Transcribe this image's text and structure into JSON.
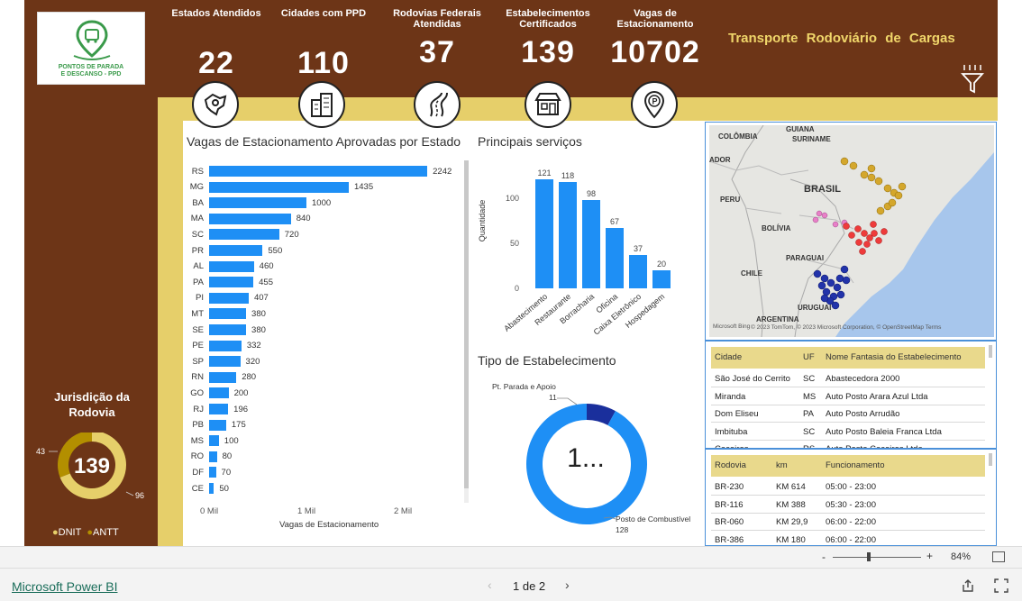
{
  "header": {
    "title": "Transporte Rodoviário de Cargas",
    "kpis": [
      {
        "label": "Estados Atendidos",
        "value": "22",
        "icon": "map-pin-icon"
      },
      {
        "label": "Cidades com PPD",
        "value": "110",
        "icon": "buildings-icon"
      },
      {
        "label": "Rodovias Federais Atendidas",
        "value": "37",
        "icon": "road-icon"
      },
      {
        "label": "Estabelecimentos Certificados",
        "value": "139",
        "icon": "store-icon"
      },
      {
        "label": "Vagas de Estacionamento",
        "value": "10702",
        "icon": "parking-icon"
      }
    ]
  },
  "logo": {
    "line1": "PONTOS DE PARADA",
    "line2": "E DESCANSO - PPD"
  },
  "jurisdiction": {
    "title": "Jurisdição da Rodovia",
    "center": "139",
    "dnit": 96,
    "antt": 43,
    "legend": [
      "DNIT",
      "ANTT"
    ],
    "colors": {
      "dnit": "#e6cf6a",
      "antt": "#b38f00"
    }
  },
  "parking_chart": {
    "title": "Vagas de Estacionamento Aprovadas por Estado",
    "xlabel": "Vagas de Estacionamento",
    "ticks": [
      "0 Mil",
      "1 Mil",
      "2 Mil"
    ]
  },
  "services_chart": {
    "title": "Principais serviços",
    "ylabel": "Quantidade",
    "yticks": [
      "100",
      "50",
      "0"
    ]
  },
  "type_chart": {
    "title": "Tipo de Estabelecimento",
    "center": "1...",
    "label_ppd": "Pt. Parada e Apoio",
    "value_ppd": "11",
    "label_fuel": "Posto de Combustível",
    "value_fuel": "128"
  },
  "chart_data": [
    {
      "type": "bar",
      "title": "Vagas de Estacionamento Aprovadas por Estado",
      "xlabel": "Vagas de Estacionamento",
      "categories": [
        "RS",
        "MG",
        "BA",
        "MA",
        "SC",
        "PR",
        "AL",
        "PA",
        "PI",
        "MT",
        "SE",
        "PE",
        "SP",
        "RN",
        "GO",
        "RJ",
        "PB",
        "MS",
        "RO",
        "DF",
        "CE"
      ],
      "values": [
        2242,
        1435,
        1000,
        840,
        720,
        550,
        460,
        455,
        407,
        380,
        380,
        332,
        320,
        280,
        200,
        196,
        175,
        100,
        80,
        70,
        50
      ],
      "xlim": [
        0,
        2500
      ]
    },
    {
      "type": "bar",
      "title": "Principais serviços",
      "ylabel": "Quantidade",
      "categories": [
        "Abastecimento",
        "Restaurante",
        "Borracharia",
        "Oficina",
        "Caixa Eletrônico",
        "Hospedagem"
      ],
      "values": [
        121,
        118,
        98,
        67,
        37,
        20
      ],
      "ylim": [
        0,
        130
      ]
    },
    {
      "type": "pie",
      "title": "Tipo de Estabelecimento",
      "categories": [
        "Posto de Combustível",
        "Pt. Parada e Apoio"
      ],
      "values": [
        128,
        11
      ]
    },
    {
      "type": "pie",
      "title": "Jurisdição da Rodovia",
      "categories": [
        "DNIT",
        "ANTT"
      ],
      "values": [
        96,
        43
      ]
    }
  ],
  "map": {
    "labels": [
      "COLÔMBIA",
      "GUIANA",
      "SURINAME",
      "ADOR",
      "BRASIL",
      "PERU",
      "BOLÍVIA",
      "PARAGUAI",
      "CHILE",
      "URUGUAI",
      "ARGENTINA"
    ],
    "attribution": "© 2023 TomTom, © 2023 Microsoft Corporation, © OpenStreetMap  Terms",
    "brand": "Microsoft Bing"
  },
  "table1": {
    "headers": [
      "Cidade",
      "UF",
      "Nome Fantasia do Estabelecimento"
    ],
    "rows": [
      [
        "São José do Cerrito",
        "SC",
        "Abastecedora 2000"
      ],
      [
        "Miranda",
        "MS",
        "Auto Posto Arara Azul Ltda"
      ],
      [
        "Dom Eliseu",
        "PA",
        "Auto Posto Arrudão"
      ],
      [
        "Imbituba",
        "SC",
        "Auto Posto Baleia Franca Ltda"
      ],
      [
        "Cacoiros",
        "RS",
        "Auto Posto Cacoiros Ltda"
      ]
    ]
  },
  "table2": {
    "headers": [
      "Rodovia",
      "km",
      "Funcionamento"
    ],
    "rows": [
      [
        "BR-230",
        "KM 614",
        "05:00 - 23:00"
      ],
      [
        "BR-116",
        "KM 388",
        "05:30 - 23:00"
      ],
      [
        "BR-060",
        "KM 29,9",
        "06:00 - 22:00"
      ],
      [
        "BR-386",
        "KM 180",
        "06:00 - 22:00"
      ]
    ]
  },
  "status": {
    "zoom": "84%",
    "minus": "-",
    "plus": "+"
  },
  "footer": {
    "brand": "Microsoft Power BI",
    "page": "1 de 2"
  }
}
